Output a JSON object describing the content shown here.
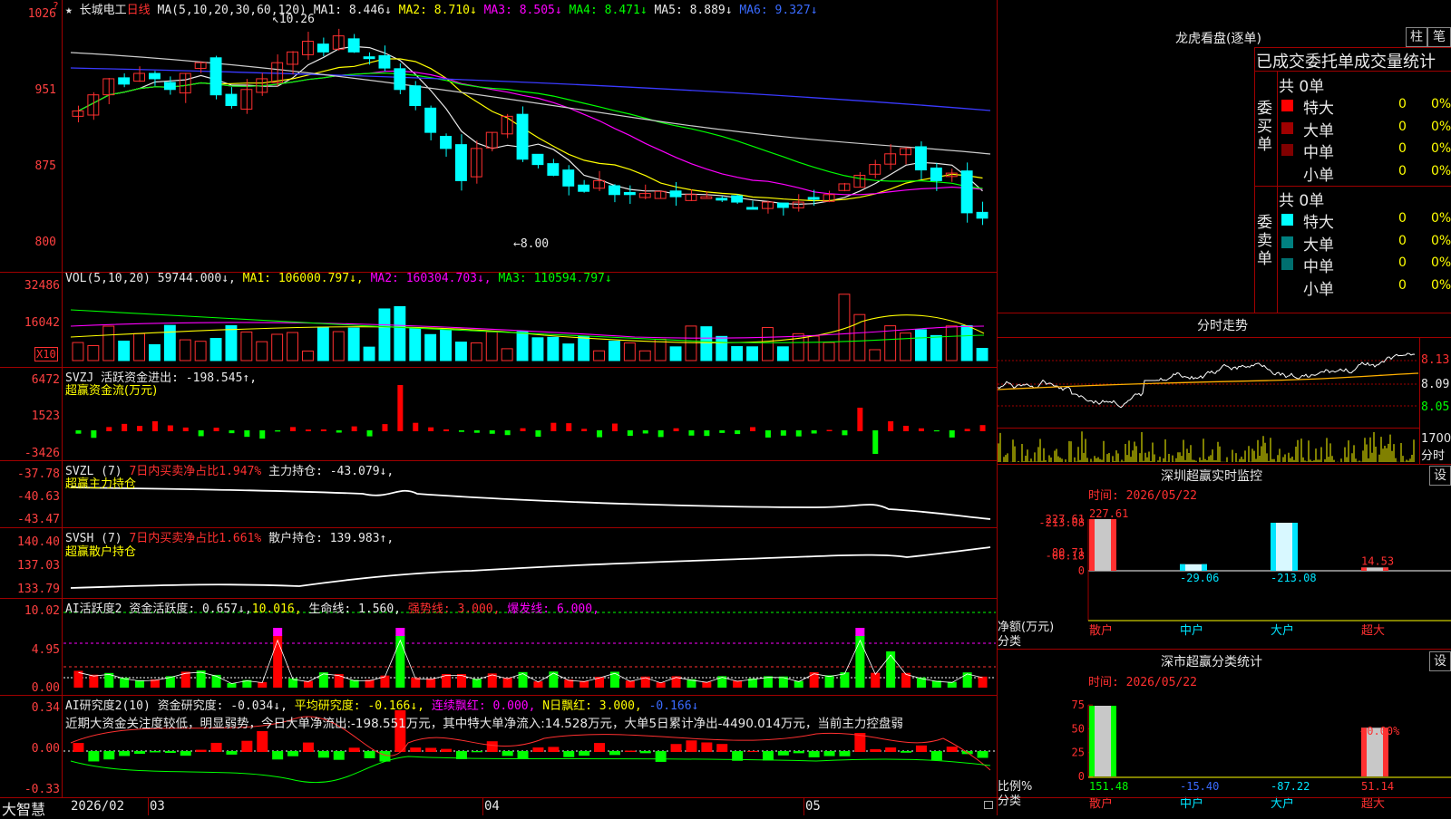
{
  "stock": {
    "star": "★",
    "name": "长城电工",
    "period": "日线",
    "ma_header": "MA(5,10,20,30,60,120)",
    "ma": [
      {
        "label": "MA1:",
        "value": "8.446",
        "arrow": "↓",
        "color": "#e8e8e8"
      },
      {
        "label": "MA2:",
        "value": "8.710",
        "arrow": "↓",
        "color": "#ffff00"
      },
      {
        "label": "MA3:",
        "value": "8.505",
        "arrow": "↓",
        "color": "#ff00ff"
      },
      {
        "label": "MA4:",
        "value": "8.471",
        "arrow": "↓",
        "color": "#00ff00"
      },
      {
        "label": "MA5:",
        "value": "8.889",
        "arrow": "↓",
        "color": "#e8e8e8"
      },
      {
        "label": "MA6:",
        "value": "9.327",
        "arrow": "↓",
        "color": "#3a6bff"
      }
    ],
    "high_mark": "10.26",
    "low_mark": "←8.00",
    "yaxis": [
      "1026",
      "951",
      "875",
      "800"
    ]
  },
  "vol": {
    "header": "VOL(5,10,20)",
    "value": "59744.000↓,",
    "ma": [
      {
        "label": "MA1:",
        "value": "106000.797↓,",
        "color": "#ffff00"
      },
      {
        "label": "MA2:",
        "value": "160304.703↓,",
        "color": "#ff00ff"
      },
      {
        "label": "MA3:",
        "value": "110594.797↓",
        "color": "#00ff00"
      }
    ],
    "yaxis": [
      "32486",
      "16042"
    ],
    "unit": "X10"
  },
  "svzj": {
    "header": "SVZJ",
    "line1": "活跃资金进出: -198.545↑,",
    "line2": "超赢资金流(万元)",
    "yaxis": [
      "6472",
      "1523",
      "-3426"
    ]
  },
  "svzl": {
    "header": "SVZL (7)",
    "pct": "7日内买卖净占比1.947%",
    "hold": "主力持仓: -43.079↓,",
    "line2": "超赢主力持仓",
    "yaxis": [
      "-37.78",
      "-40.63",
      "-43.47"
    ]
  },
  "svsh": {
    "header": "SVSH (7)",
    "pct": "7日内买卖净占比1.661%",
    "hold": "散户持仓: 139.983↑,",
    "line2": "超赢散户持仓",
    "yaxis": [
      "140.40",
      "137.03",
      "133.79"
    ]
  },
  "ai_active": {
    "header": "AI活跃度2",
    "a": "资金活跃度: 0.657↓,",
    "b": "10.016,",
    "c": "生命线: 1.560,",
    "d": "强势线: 3.000,",
    "e": "爆发线: 6.000,",
    "yaxis": [
      "10.02",
      "4.95",
      "0.00"
    ]
  },
  "ai_research": {
    "header": "AI研究度2(10)",
    "a": "资金研究度: -0.034↓,",
    "b": "平均研究度: -0.166↓,",
    "c": "连续飘红: 0.000,",
    "d": "N日飘红: 3.000,",
    "e": "-0.166↓",
    "commentary": "近期大资金关注度较低，明显弱势，今日大单净流出:-198.551万元，其中特大单净流入:14.528万元，大单5日累计净出-4490.014万元，当前主力控盘弱",
    "yaxis": [
      "0.34",
      "0.00",
      "-0.33"
    ]
  },
  "bottom": {
    "brand": "大智慧",
    "dates": [
      "2026/02",
      "03",
      "04",
      "05"
    ]
  },
  "right": {
    "lhb_title": "龙虎看盘(逐单)",
    "btn_zhu": "柱",
    "btn_bi": "笔",
    "stats_header": "已成交委托单成交量统计",
    "buy_label": "委买单",
    "sell_label": "委卖单",
    "buy_total": "共 0单",
    "sell_total": "共 0单",
    "buy_rows": [
      {
        "name": "特大",
        "count": "0",
        "pct": "0%",
        "color": "#ff0000"
      },
      {
        "name": "大单",
        "count": "0",
        "pct": "0%",
        "color": "#a00000"
      },
      {
        "name": "中单",
        "count": "0",
        "pct": "0%",
        "color": "#800000"
      },
      {
        "name": "小单",
        "count": "0",
        "pct": "0%",
        "color": ""
      }
    ],
    "sell_rows": [
      {
        "name": "特大",
        "count": "0",
        "pct": "0%",
        "color": "#00ffff"
      },
      {
        "name": "大单",
        "count": "0",
        "pct": "0%",
        "color": "#008080"
      },
      {
        "name": "中单",
        "count": "0",
        "pct": "0%",
        "color": "#006f6f"
      },
      {
        "name": "小单",
        "count": "0",
        "pct": "0%",
        "color": ""
      }
    ],
    "intraday_title": "分时走势",
    "intraday_yaxis": [
      "8.13",
      "8.09",
      "8.05"
    ],
    "intraday_vol": "1700",
    "intraday_unit": "分时",
    "sz_monitor": {
      "title": "深圳超赢实时监控",
      "btn": "设",
      "time": "时间: 2026/05/22",
      "yaxis": [
        "227.61",
        "80.71",
        "0",
        "-66.18",
        "-213.08"
      ],
      "ylabel": "净额(万元)",
      "xlabel": "分类",
      "cats": [
        "散户",
        "中户",
        "大户",
        "超大"
      ],
      "values": [
        227.61,
        -29.06,
        -213.08,
        14.53
      ],
      "value_labels": [
        "227.61",
        "-29.06",
        "-213.08",
        "14.53"
      ]
    },
    "sz_class": {
      "title": "深市超赢分类统计",
      "btn": "设",
      "time": "时间: 2026/05/22",
      "yaxis": [
        "75",
        "50",
        "25",
        "0"
      ],
      "ylabel": "比例%",
      "xlabel": "分类",
      "cats": [
        "散户",
        "中户",
        "大户",
        "超大"
      ],
      "values": [
        151.48,
        -15.4,
        -87.22,
        51.14
      ],
      "value_labels": [
        "151.48",
        "-15.40",
        "-87.22",
        "51.14"
      ],
      "top_label": "+0.00%"
    }
  }
}
